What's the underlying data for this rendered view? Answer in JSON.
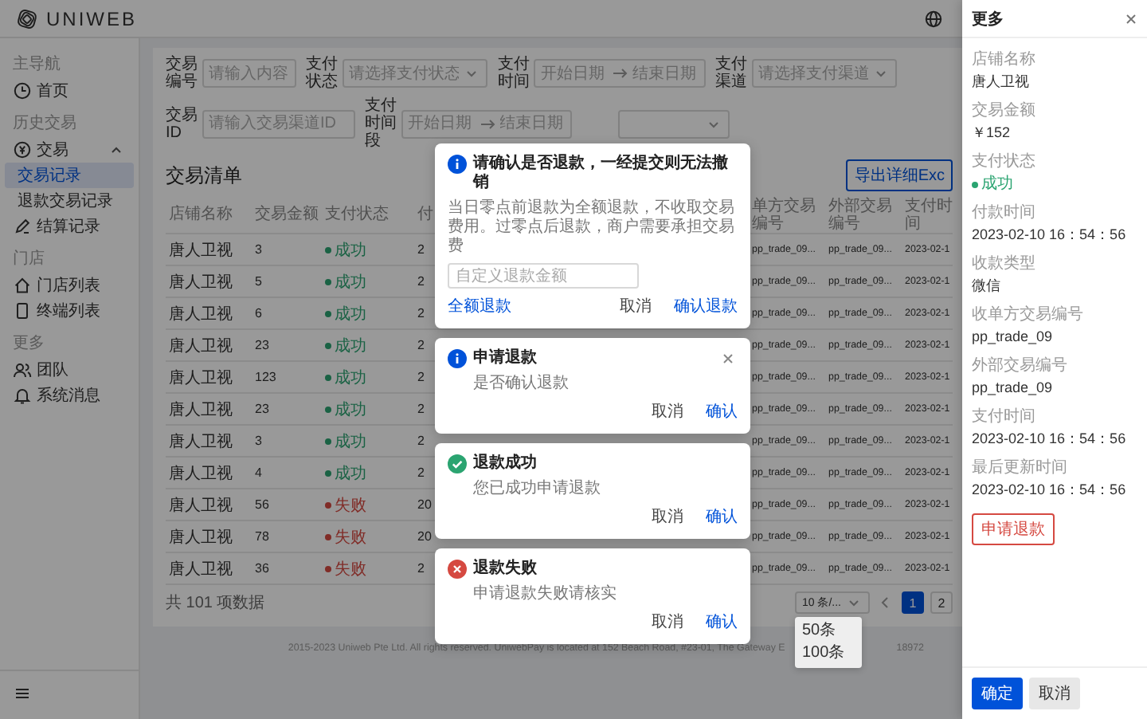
{
  "header": {
    "logo": "UNIWEB"
  },
  "sidebar": {
    "groups": [
      {
        "label": "主导航",
        "items": [
          {
            "label": "首页",
            "selected": false
          }
        ]
      },
      {
        "label": "历史交易",
        "items": [
          {
            "label": "交易",
            "selected": false,
            "expanded": true,
            "children": [
              {
                "label": "交易记录",
                "selected": true
              },
              {
                "label": "退款交易记录",
                "selected": false
              }
            ]
          },
          {
            "label": "结算记录",
            "selected": false
          }
        ]
      },
      {
        "label": "门店",
        "items": [
          {
            "label": "门店列表",
            "selected": false
          },
          {
            "label": "终端列表",
            "selected": false
          }
        ]
      },
      {
        "label": "更多",
        "items": [
          {
            "label": "团队",
            "selected": false
          },
          {
            "label": "系统消息",
            "selected": false
          }
        ]
      }
    ]
  },
  "filters": [
    [
      {
        "kind": "input",
        "label": "交易编号",
        "placeholder": "请输入内容"
      },
      {
        "kind": "select",
        "label": "支付状态",
        "placeholder": "请选择支付状态"
      },
      {
        "kind": "range",
        "label": "支付时间",
        "placeholder": "开始日期",
        "placeholder_end": "结束日期"
      },
      {
        "kind": "select",
        "label": "支付渠道",
        "placeholder": "请选择支付渠道"
      }
    ],
    [
      {
        "kind": "input",
        "label": "交易ID",
        "placeholder": "请输入交易渠道ID"
      },
      {
        "kind": "range",
        "label": "支付时间段",
        "placeholder": "开始日期",
        "placeholder_end": "结束日期"
      },
      {
        "kind": "select"
      }
    ]
  ],
  "table": {
    "title": "交易清单",
    "export_button": "导出详细Exc",
    "columns": [
      "店铺名称",
      "交易金额",
      "支付状态",
      "付",
      "单方交易编号",
      "外部交易编号",
      "支付时间"
    ],
    "rows": [
      {
        "store": "唐人卫视",
        "amount": "3",
        "status": {
          "text": "成功",
          "color": "#1a6244"
        },
        "column_4": "2",
        "receiver_no": "pp_trade_09...",
        "external_no": "pp_trade_09...",
        "pay_time": "2023-02-1"
      },
      {
        "store": "唐人卫视",
        "amount": "5",
        "status": {
          "text": "成功",
          "color": "#1a6244"
        },
        "column_4": "2",
        "receiver_no": "pp_trade_09...",
        "external_no": "pp_trade_09...",
        "pay_time": "2023-02-1"
      },
      {
        "store": "唐人卫视",
        "amount": "6",
        "status": {
          "text": "成功",
          "color": "#1a6244"
        },
        "column_4": "2",
        "receiver_no": "pp_trade_09...",
        "external_no": "pp_trade_09...",
        "pay_time": "2023-02-1"
      },
      {
        "store": "唐人卫视",
        "amount": "23",
        "status": {
          "text": "成功",
          "color": "#1a6244"
        },
        "column_4": "2",
        "receiver_no": "pp_trade_09...",
        "external_no": "pp_trade_09...",
        "pay_time": "2023-02-1"
      },
      {
        "store": "唐人卫视",
        "amount": "123",
        "status": {
          "text": "成功",
          "color": "#1a6244"
        },
        "column_4": "2",
        "receiver_no": "pp_trade_09...",
        "external_no": "pp_trade_09...",
        "pay_time": "2023-02-1"
      },
      {
        "store": "唐人卫视",
        "amount": "23",
        "status": {
          "text": "成功",
          "color": "#1a6244"
        },
        "column_4": "2",
        "receiver_no": "pp_trade_09...",
        "external_no": "pp_trade_09...",
        "pay_time": "2023-02-1"
      },
      {
        "store": "唐人卫视",
        "amount": "3",
        "status": {
          "text": "成功",
          "color": "#1a6244"
        },
        "column_4": "2",
        "receiver_no": "pp_trade_09...",
        "external_no": "pp_trade_09...",
        "pay_time": "2023-02-1"
      },
      {
        "store": "唐人卫视",
        "amount": "4",
        "status": {
          "text": "成功",
          "color": "#1a6244"
        },
        "column_4": "2",
        "receiver_no": "pp_trade_09...",
        "external_no": "pp_trade_09...",
        "pay_time": "2023-02-1"
      },
      {
        "store": "唐人卫视",
        "amount": "56",
        "status": {
          "text": "失败",
          "color": "#802c27"
        },
        "column_4": "20",
        "receiver_no": "pp_trade_09...",
        "external_no": "pp_trade_09...",
        "pay_time": "2023-02-1"
      },
      {
        "store": "唐人卫视",
        "amount": "78",
        "status": {
          "text": "失败",
          "color": "#802c27"
        },
        "column_4": "20",
        "receiver_no": "pp_trade_09...",
        "external_no": "pp_trade_09...",
        "pay_time": "2023-02-1"
      },
      {
        "store": "唐人卫视",
        "amount": "36",
        "status": {
          "text": "失败",
          "color": "#802c27"
        },
        "column_4": "2",
        "receiver_no": "pp_trade_09...",
        "external_no": "pp_trade_09...",
        "pay_time": "2023-02-1"
      }
    ],
    "total": "共 101 项数据",
    "pagination": {
      "page_size": "10 条/...",
      "page_size_options": [
        "50条",
        "100条"
      ],
      "pages": [
        {
          "label": "1",
          "selected": true
        },
        {
          "label": "2",
          "selected": false
        }
      ]
    }
  },
  "footer": {
    "text": "2015-2023 Uniweb Pte Ltd. All rights reserved. UniwebPay is located at 152 Beach Road, #23-01, The Gateway E",
    "tail": "18972"
  },
  "dialogs": [
    {
      "kind": "info",
      "title": "请确认是否退款，一经提交则无法撤销",
      "description": "当日零点前退款为全额退款，不收取交易费用。过零点后退款，商户需要承担交易费",
      "closable": false,
      "input_placeholder": "自定义退款金额",
      "buttons": [
        {
          "label": "全额退款",
          "kind": "extra"
        },
        {
          "label": "取消",
          "kind": "cancel"
        },
        {
          "label": "确认退款",
          "kind": "confirm"
        }
      ]
    },
    {
      "kind": "info",
      "title": "申请退款",
      "description": "是否确认退款",
      "closable": true,
      "buttons": [
        {
          "label": "取消",
          "kind": "cancel"
        },
        {
          "label": "确认",
          "kind": "confirm"
        }
      ]
    },
    {
      "kind": "success",
      "title": "退款成功",
      "description": "您已成功申请退款",
      "closable": false,
      "buttons": [
        {
          "label": "取消",
          "kind": "cancel"
        },
        {
          "label": "确认",
          "kind": "confirm"
        }
      ]
    },
    {
      "kind": "error",
      "title": "退款失败",
      "description": "申请退款失败请核实",
      "closable": false,
      "buttons": [
        {
          "label": "取消",
          "kind": "cancel"
        },
        {
          "label": "确认",
          "kind": "confirm"
        }
      ]
    }
  ],
  "drawer": {
    "title": "更多",
    "fields": [
      {
        "label": "店铺名称",
        "value": "唐人卫视"
      },
      {
        "label": "交易金额",
        "value": "￥152"
      },
      {
        "label": "支付状态",
        "value": "成功",
        "color": "#2ba471"
      },
      {
        "label": "付款时间",
        "value": "2023-02-10 16：54：56"
      },
      {
        "label": "收款类型",
        "value": "微信"
      },
      {
        "label": "收单方交易编号",
        "value": "pp_trade_09"
      },
      {
        "label": "外部交易编号",
        "value": "pp_trade_09"
      },
      {
        "label": "支付时间",
        "value": "2023-02-10 16：54：56"
      },
      {
        "label": "最后更新时间",
        "value": "2023-02-10 16：54：56"
      }
    ],
    "action": "申请退款",
    "buttons": [
      {
        "label": "确定",
        "kind": "primary"
      },
      {
        "label": "取消",
        "kind": "default"
      }
    ]
  }
}
